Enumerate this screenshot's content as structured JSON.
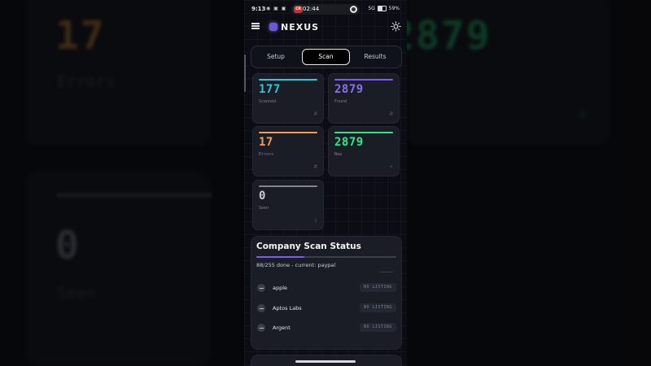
{
  "background": {
    "errors_value": "17",
    "errors_label": "Errors",
    "seen_value": "0",
    "seen_label": "Seen",
    "new_value": "2879",
    "plus_symbol": "+"
  },
  "status_bar": {
    "time": "9:13",
    "icons": "◉ ▣ ▣",
    "rec_label": "CR",
    "clock": "02:44",
    "signal": "5G",
    "battery": "59%"
  },
  "header": {
    "brand": "NEXUS"
  },
  "tabs": [
    {
      "label": "Setup",
      "active": false
    },
    {
      "label": "Scan",
      "active": true
    },
    {
      "label": "Results",
      "active": false
    }
  ],
  "stats": {
    "scanned": {
      "value": "177",
      "label": "Scanned",
      "icon": "#",
      "color": "#2ec8d4"
    },
    "found": {
      "value": "2879",
      "label": "Found",
      "icon": "#",
      "color": "#7c5cf0"
    },
    "errors": {
      "value": "17",
      "label": "Errors",
      "icon": "#",
      "color": "#f0a050"
    },
    "new": {
      "value": "2879",
      "label": "New",
      "icon": "+",
      "color": "#2ee888"
    },
    "seen": {
      "value": "0",
      "label": "Seen",
      "icon": "▯",
      "color": "#c8ccd6"
    }
  },
  "company_scan": {
    "title": "Company Scan Status",
    "progress_text": "88/255 done - current: paypal",
    "progress_fraction": 0.345,
    "companies": [
      {
        "name": "apple",
        "status": "NO LISTING"
      },
      {
        "name": "Aptos Labs",
        "status": "NO LISTING"
      },
      {
        "name": "Argent",
        "status": "NO LISTING"
      }
    ]
  }
}
